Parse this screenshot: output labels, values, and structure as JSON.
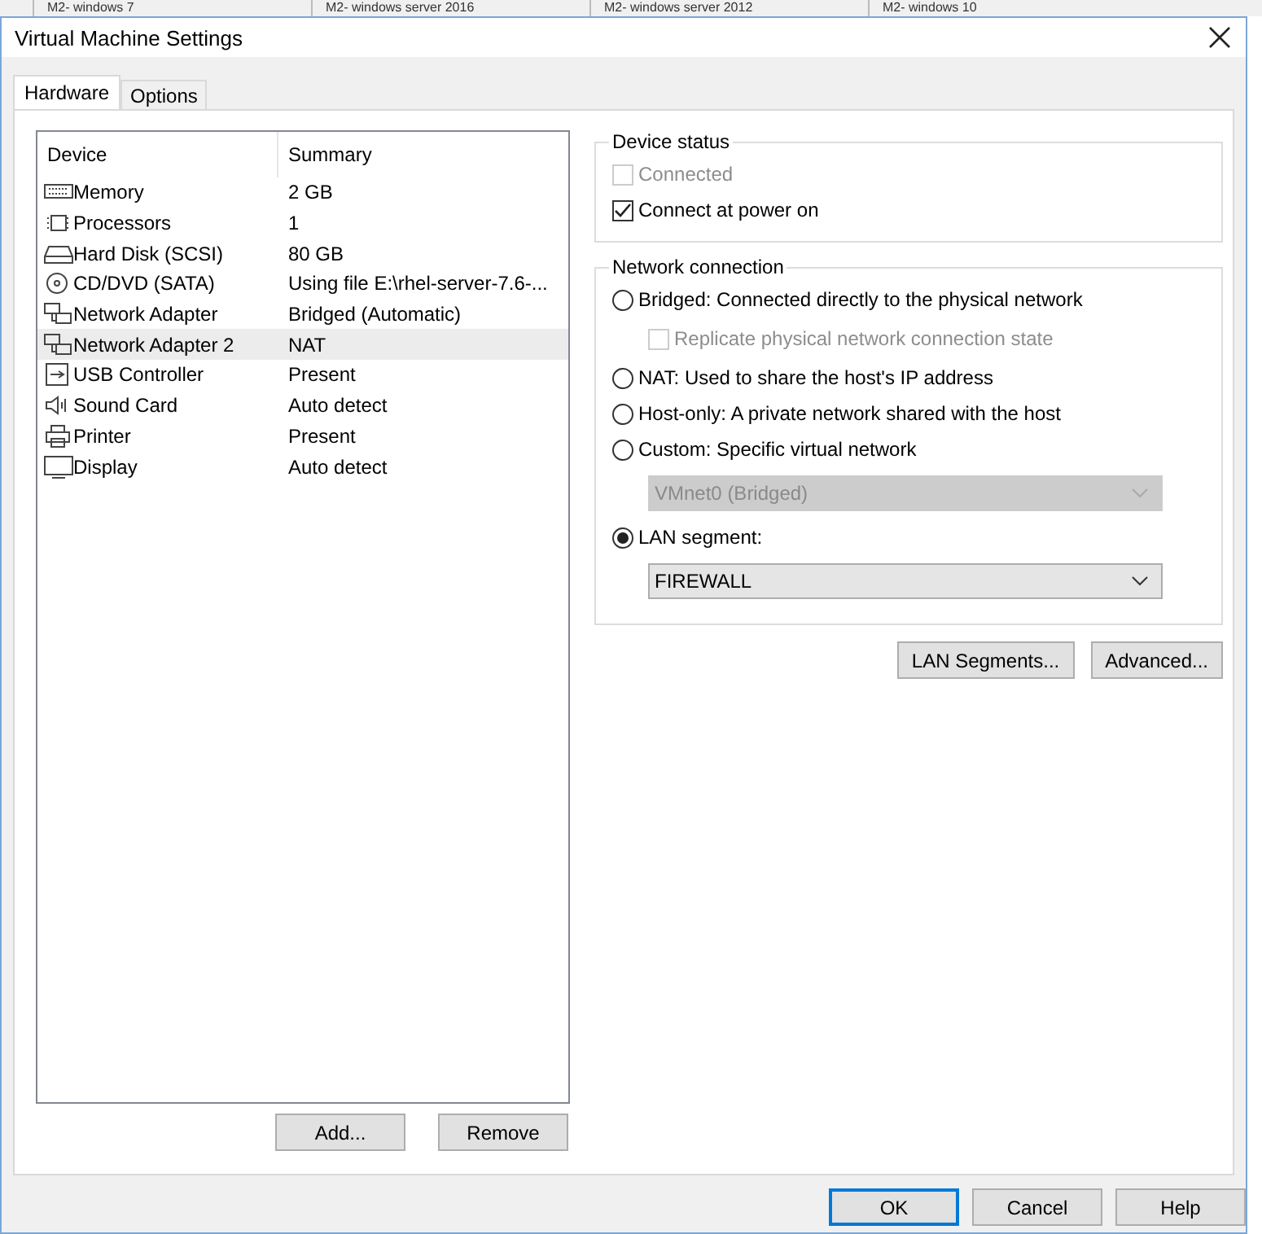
{
  "background_tabs": [
    {
      "label": "M2- windows 7"
    },
    {
      "label": "M2- windows server 2016"
    },
    {
      "label": "M2- windows server 2012"
    },
    {
      "label": "M2- windows 10"
    }
  ],
  "window": {
    "title": "Virtual Machine Settings"
  },
  "tabs": [
    {
      "label": "Hardware",
      "selected": true
    },
    {
      "label": "Options",
      "selected": false
    }
  ],
  "device_table": {
    "columns": [
      "Device",
      "Summary"
    ],
    "rows": [
      {
        "kind": "memory",
        "device": "Memory",
        "summary": "2 GB",
        "selected": false
      },
      {
        "kind": "cpu",
        "device": "Processors",
        "summary": "1",
        "selected": false
      },
      {
        "kind": "disk",
        "device": "Hard Disk (SCSI)",
        "summary": "80 GB",
        "selected": false
      },
      {
        "kind": "cd",
        "device": "CD/DVD (SATA)",
        "summary": "Using file E:\\rhel-server-7.6-...",
        "selected": false
      },
      {
        "kind": "network",
        "device": "Network Adapter",
        "summary": "Bridged (Automatic)",
        "selected": false
      },
      {
        "kind": "network",
        "device": "Network Adapter 2",
        "summary": "NAT",
        "selected": true
      },
      {
        "kind": "usb",
        "device": "USB Controller",
        "summary": "Present",
        "selected": false
      },
      {
        "kind": "sound",
        "device": "Sound Card",
        "summary": "Auto detect",
        "selected": false
      },
      {
        "kind": "printer",
        "device": "Printer",
        "summary": "Present",
        "selected": false
      },
      {
        "kind": "display",
        "device": "Display",
        "summary": "Auto detect",
        "selected": false
      }
    ]
  },
  "list_buttons": [
    "Add...",
    "Remove"
  ],
  "device_status": {
    "title": "Device status",
    "checkboxes": [
      {
        "label": "Connected",
        "checked": false,
        "disabled": true
      },
      {
        "label": "Connect at power on",
        "checked": true,
        "disabled": false
      }
    ]
  },
  "network_connection": {
    "title": "Network connection",
    "items": [
      {
        "kind": "radio",
        "label": "Bridged: Connected directly to the physical network",
        "selected": false,
        "disabled": false
      },
      {
        "kind": "checkbox",
        "label": "Replicate physical network connection state",
        "checked": false,
        "disabled": true
      },
      {
        "kind": "radio",
        "label": "NAT: Used to share the host's IP address",
        "selected": false,
        "disabled": false
      },
      {
        "kind": "radio",
        "label": "Host-only: A private network shared with the host",
        "selected": false,
        "disabled": false
      },
      {
        "kind": "radio",
        "label": "Custom: Specific virtual network",
        "selected": false,
        "disabled": false
      },
      {
        "kind": "dropdown",
        "value": "VMnet0 (Bridged)",
        "disabled": true
      },
      {
        "kind": "radio",
        "label": "LAN segment:",
        "selected": true,
        "disabled": false
      },
      {
        "kind": "dropdown",
        "value": "FIREWALL",
        "disabled": false
      }
    ]
  },
  "network_buttons": [
    "LAN Segments...",
    "Advanced..."
  ],
  "dialog_buttons": [
    {
      "label": "OK",
      "default": true
    },
    {
      "label": "Cancel",
      "default": false
    },
    {
      "label": "Help",
      "default": false
    }
  ]
}
